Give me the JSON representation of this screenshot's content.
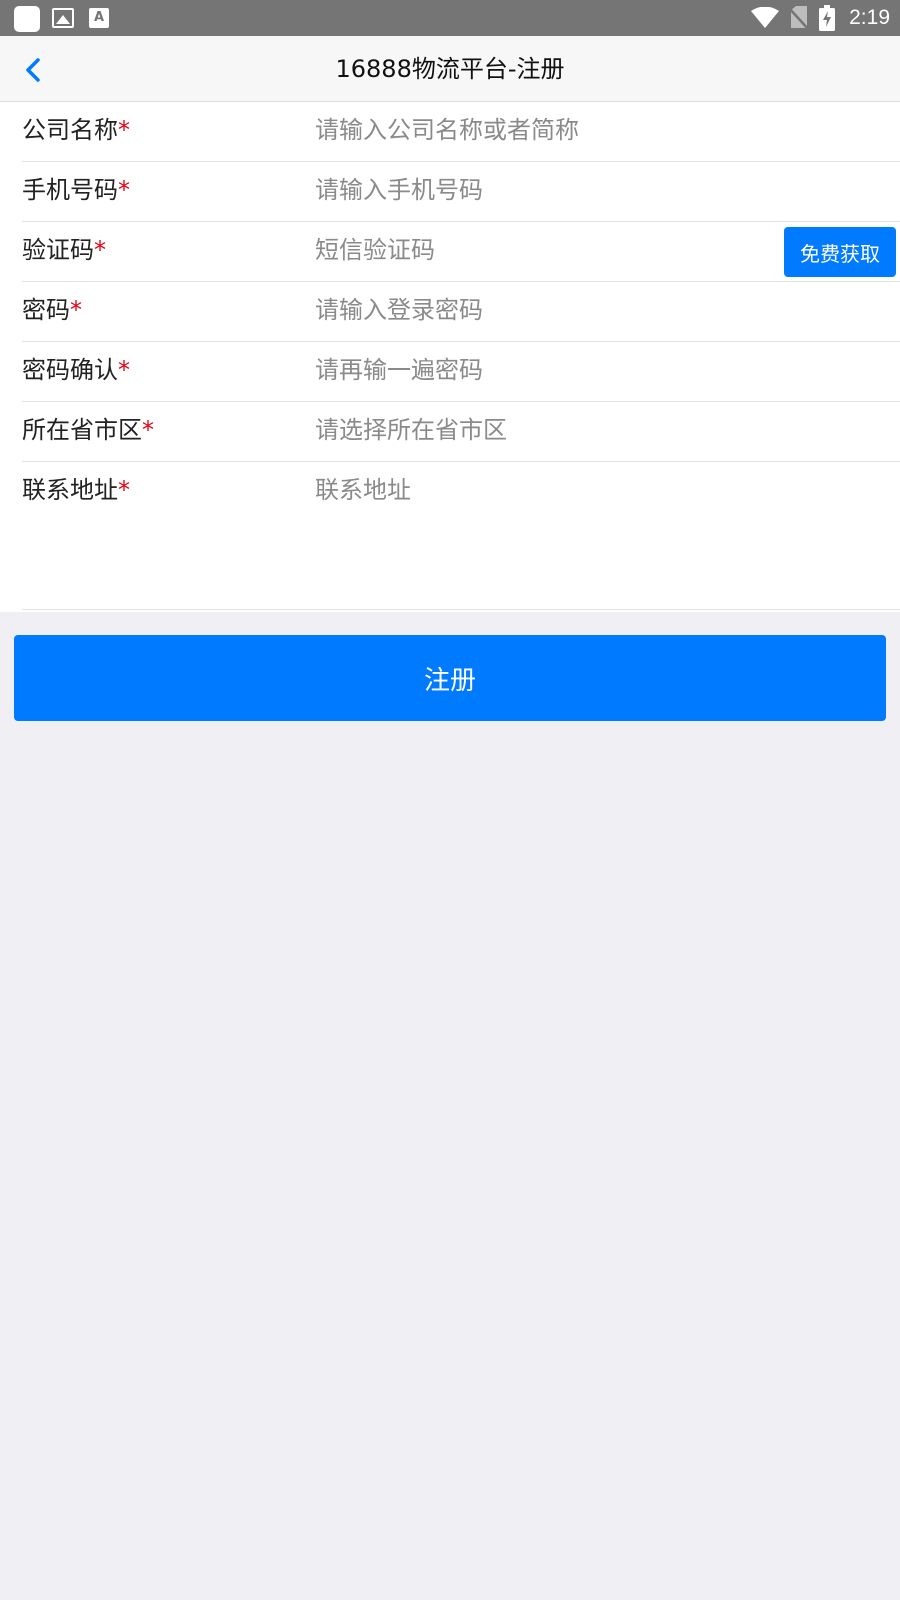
{
  "status_bar": {
    "time": "2:19",
    "icons": [
      "app-icon",
      "image-icon",
      "text-a-icon",
      "wifi-icon",
      "no-sim-icon",
      "battery-charging-icon"
    ],
    "notif_letter": "A"
  },
  "header": {
    "title": "16888物流平台-注册",
    "back_icon": "chevron-left-icon"
  },
  "form": {
    "required_mark": "*",
    "company": {
      "label": "公司名称",
      "placeholder": "请输入公司名称或者简称"
    },
    "phone": {
      "label": "手机号码",
      "placeholder": "请输入手机号码"
    },
    "code": {
      "label": "验证码",
      "placeholder": "短信验证码",
      "button": "免费获取"
    },
    "password": {
      "label": "密码",
      "placeholder": "请输入登录密码"
    },
    "password_confirm": {
      "label": "密码确认",
      "placeholder": "请再输一遍密码"
    },
    "region": {
      "label": "所在省市区",
      "placeholder": "请选择所在省市区"
    },
    "address": {
      "label": "联系地址",
      "placeholder": "联系地址"
    }
  },
  "register_button": "注册",
  "colors": {
    "accent": "#007aff",
    "required": "#e60012",
    "status_bar": "#757575",
    "background": "#efeff4"
  }
}
